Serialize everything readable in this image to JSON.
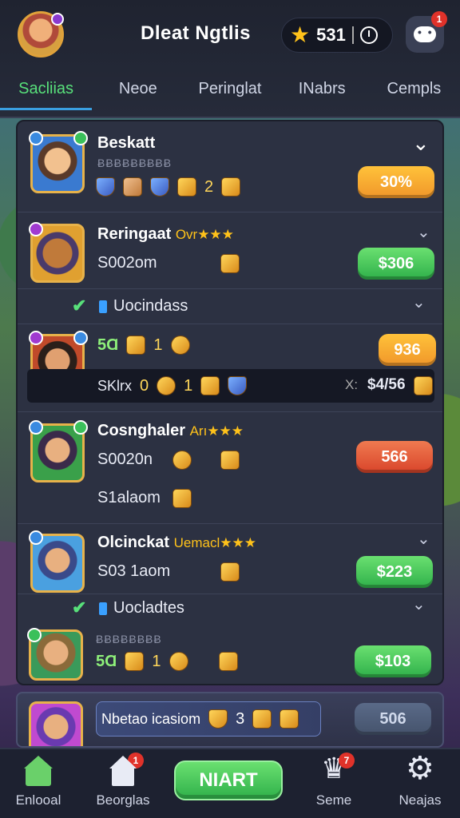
{
  "header": {
    "title": "Dleat Ngtlis",
    "currency_value": "531",
    "chat_badge": "1"
  },
  "tabs": [
    {
      "label": "Sacliias",
      "active": true
    },
    {
      "label": "Neoe"
    },
    {
      "label": "Peringlat"
    },
    {
      "label": "INabrs"
    },
    {
      "label": "Cempls"
    }
  ],
  "rows": [
    {
      "name": "Beskatt",
      "small": "ɃɃɃɃɃɃɃɃɃ",
      "count": "2",
      "pill": "30%"
    },
    {
      "name": "Reringaat",
      "name_sub": "Ovr★★★",
      "stat": "S002om",
      "pill": "$306"
    },
    {
      "sub_label": "Uocindass"
    },
    {
      "stat": "5Ɑ",
      "count": "1",
      "pill": "936",
      "strip_left": "SKlrx",
      "strip_num": "0",
      "strip_num2": "1",
      "strip_right_label": "X:",
      "strip_right_value": "$4/56"
    },
    {
      "name": "Cosnghaler",
      "name_sub": "Arı★★★",
      "stat": "S0020n",
      "stat2": "S1alaom",
      "pill": "566"
    },
    {
      "name": "Olcinckat",
      "name_sub": "Uemacl★★★",
      "stat": "S03 1aom",
      "pill": "$223"
    },
    {
      "sub_label": "Uocladtes"
    },
    {
      "small": "ɃɃɃɃɃɃɃɃ",
      "stat": "5Ɑ",
      "count": "1",
      "pill": "$103"
    }
  ],
  "bottom_card": {
    "chip_label": "Nbetao icasiom",
    "count": "3",
    "pill": "506"
  },
  "nav": {
    "items": [
      {
        "label": "Enlooal",
        "badge": ""
      },
      {
        "label": "Beorglas",
        "badge": "1"
      },
      {
        "label": "NIART"
      },
      {
        "label": "Seme",
        "badge": "7"
      },
      {
        "label": "Neajas"
      }
    ]
  }
}
